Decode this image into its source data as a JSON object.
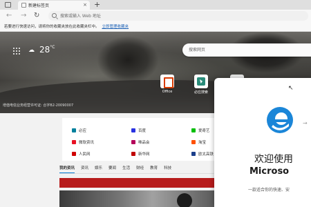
{
  "tab": {
    "title": "新建标签页",
    "close": "×"
  },
  "newtab": {
    "label": "+"
  },
  "nav": {
    "back": "←",
    "forward": "→",
    "refresh": "↻"
  },
  "address": {
    "placeholder": "搜索或输入 Web 地址"
  },
  "favbar": {
    "text": "若要进行快速访问，请将你的收藏夹放在此收藏夹栏中。",
    "link": "立即管理收藏夹"
  },
  "weather": {
    "icon": "cloud-icon",
    "temp": "28",
    "unit": "°C"
  },
  "hero_search": {
    "placeholder": "搜索网页"
  },
  "tiles": [
    {
      "label": "Office",
      "icon": "office-icon"
    },
    {
      "label": "必应搜索",
      "icon": "bing-icon"
    }
  ],
  "footnote": "增值电信业务经营许可证: 合字B2-20090007",
  "links": [
    {
      "label": "必应",
      "color": "#00809d"
    },
    {
      "label": "百度",
      "color": "#2932e1"
    },
    {
      "label": "爱奇艺",
      "color": "#00be06"
    },
    {
      "label": "微软资讯",
      "color": "#e81123"
    },
    {
      "label": "唯品会",
      "color": "#b4005a"
    },
    {
      "label": "淘宝",
      "color": "#ff5000"
    },
    {
      "label": "人民网",
      "color": "#d00000"
    },
    {
      "label": "新华网",
      "color": "#c00000"
    },
    {
      "label": "欧太高铁",
      "color": "#1b3f8b"
    }
  ],
  "news_tabs": [
    "我的资讯",
    "资讯",
    "娱乐",
    "要闻",
    "生活",
    "财经",
    "教育",
    "科技"
  ],
  "welcome": {
    "title": "欢迎使用",
    "brand": "Microso",
    "subtitle": "一款适合你的快速、安"
  }
}
